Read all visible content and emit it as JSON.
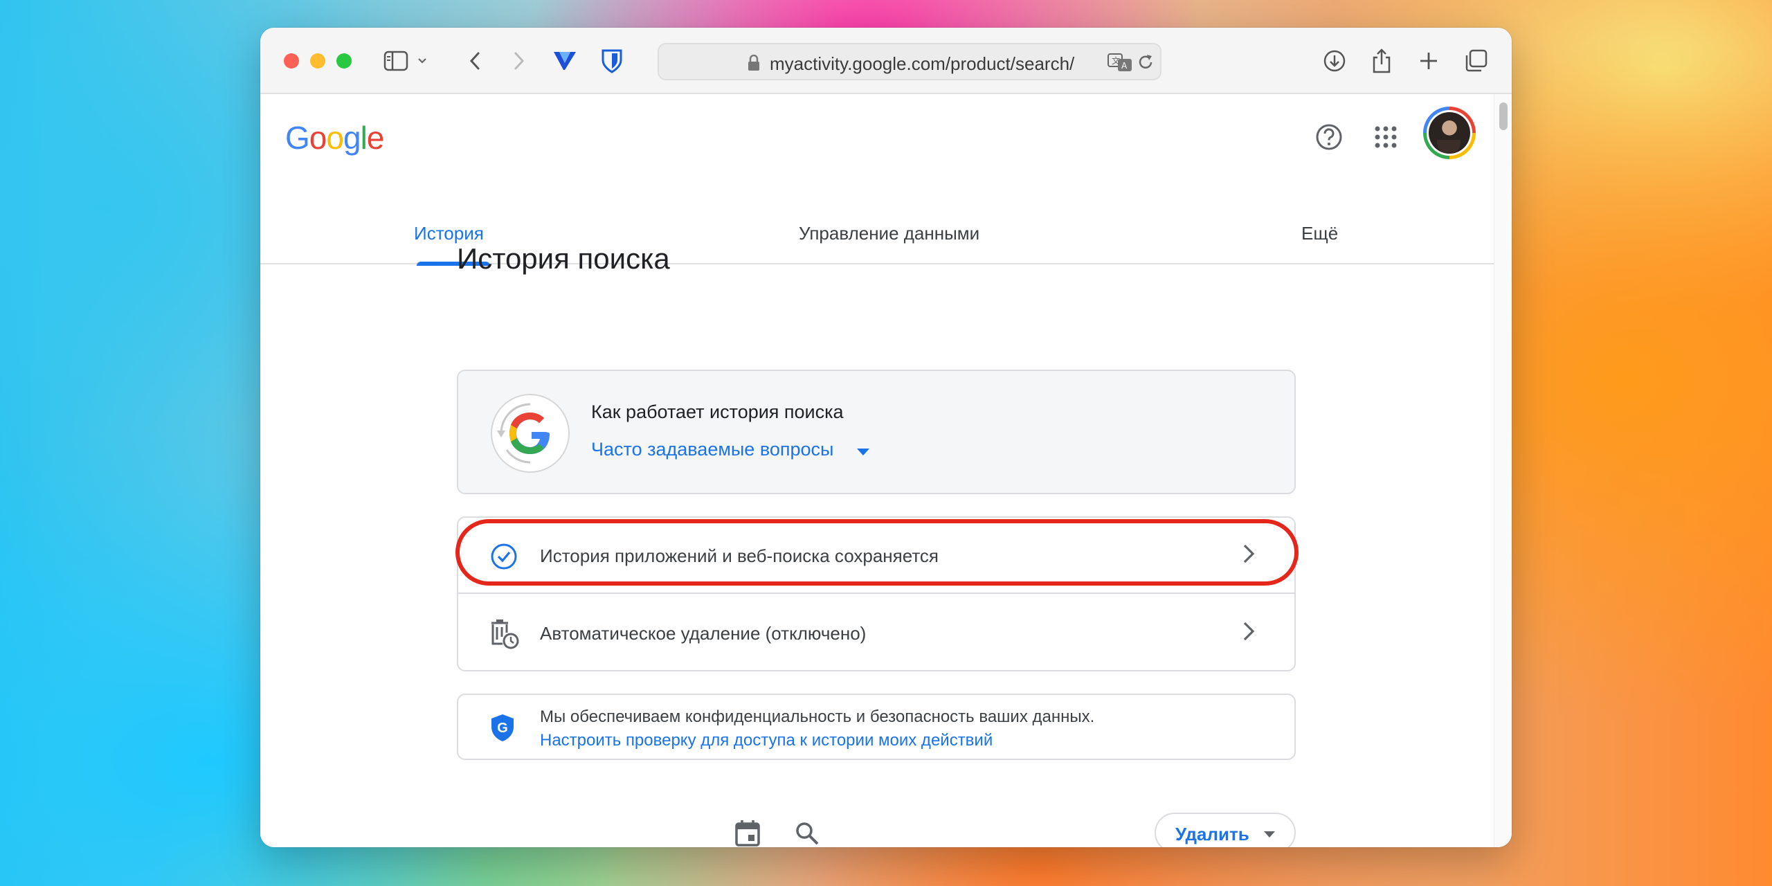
{
  "browser": {
    "url": "myactivity.google.com/product/search/",
    "icons": [
      "sidebar-icon",
      "chevron-down-icon",
      "back-icon",
      "forward-icon",
      "vpn-extension-icon",
      "bitwarden-shield-icon",
      "lock-icon",
      "translate-icon",
      "reload-icon",
      "download-icon",
      "share-icon",
      "new-tab-icon",
      "tabs-overview-icon"
    ]
  },
  "header": {
    "logo_letters": [
      {
        "ch": "G",
        "color": "#4285f4"
      },
      {
        "ch": "o",
        "color": "#ea4335"
      },
      {
        "ch": "o",
        "color": "#fbbc05"
      },
      {
        "ch": "g",
        "color": "#4285f4"
      },
      {
        "ch": "l",
        "color": "#34a853"
      },
      {
        "ch": "e",
        "color": "#ea4335"
      }
    ]
  },
  "tabs": [
    {
      "label": "История",
      "active": true
    },
    {
      "label": "Управление данными",
      "active": false
    },
    {
      "label": "Ещё",
      "active": false
    }
  ],
  "page_title": "История поиска",
  "info_card": {
    "title": "Как работает история поиска",
    "faq_link": "Часто задаваемые вопросы"
  },
  "settings": [
    {
      "label": "История приложений и веб-поиска сохраняется",
      "icon": "check-circle-icon",
      "highlighted": true
    },
    {
      "label": "Автоматическое удаление (отключено)",
      "icon": "auto-delete-icon",
      "highlighted": false
    }
  ],
  "privacy": {
    "text": "Мы обеспечиваем конфиденциальность и безопасность ваших данных.",
    "link": "Настроить проверку для доступа к истории моих действий"
  },
  "actions": {
    "delete_label": "Удалить"
  },
  "colors": {
    "accent": "#1a73e8",
    "highlight": "#e5261b"
  }
}
